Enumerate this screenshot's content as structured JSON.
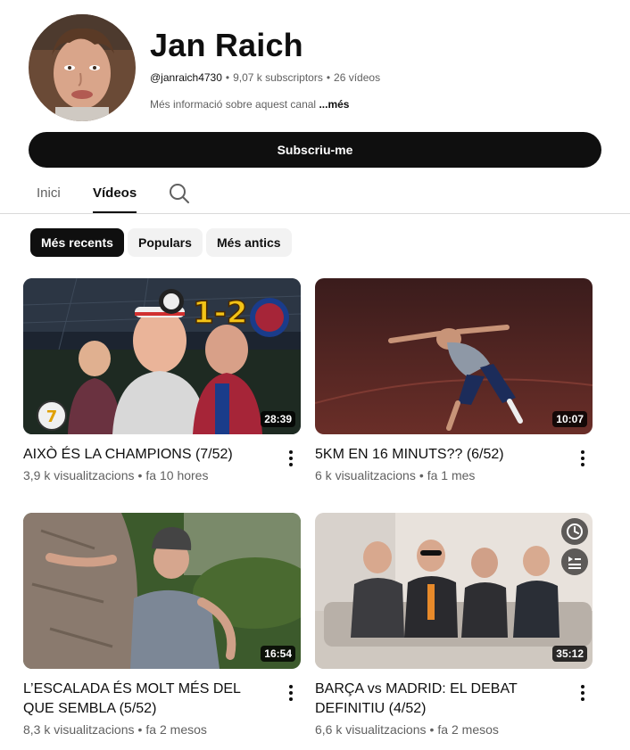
{
  "channel": {
    "name": "Jan Raich",
    "handle": "@janraich4730",
    "subscribers": "9,07 k subscriptors",
    "video_count": "26 vídeos",
    "about_text": "Més informació sobre aquest canal",
    "about_more": "...més",
    "subscribe_label": "Subscriu-me"
  },
  "tabs": [
    {
      "label": "Inici",
      "active": false
    },
    {
      "label": "Vídeos",
      "active": true
    }
  ],
  "chips": [
    {
      "label": "Més recents",
      "active": true
    },
    {
      "label": "Populars",
      "active": false
    },
    {
      "label": "Més antics",
      "active": false
    }
  ],
  "videos": [
    {
      "title": "AIXÒ ÉS LA CHAMPIONS (7/52)",
      "views": "3,9 k visualitzacions",
      "age": "fa 10 hores",
      "duration": "28:39",
      "overlay_text": "1-2",
      "badge_text": "7"
    },
    {
      "title": "5KM EN 16 MINUTS?? (6/52)",
      "views": "6 k visualitzacions",
      "age": "fa 1 mes",
      "duration": "10:07"
    },
    {
      "title": "L’ESCALADA ÉS MOLT MÉS DEL QUE SEMBLA (5/52)",
      "views": "8,3 k visualitzacions",
      "age": "fa 2 mesos",
      "duration": "16:54"
    },
    {
      "title": "BARÇA vs MADRID: EL DEBAT DEFINITIU (4/52)",
      "views": "6,6 k visualitzacions",
      "age": "fa 2 mesos",
      "duration": "35:12"
    }
  ],
  "icons": {
    "search": "search-icon",
    "more": "more-vert-icon",
    "watch_later": "clock-icon",
    "add_queue": "add-to-queue-icon"
  },
  "colors": {
    "primary_text": "#0f0f0f",
    "secondary_text": "#606060",
    "chip_inactive": "#f2f2f2"
  }
}
